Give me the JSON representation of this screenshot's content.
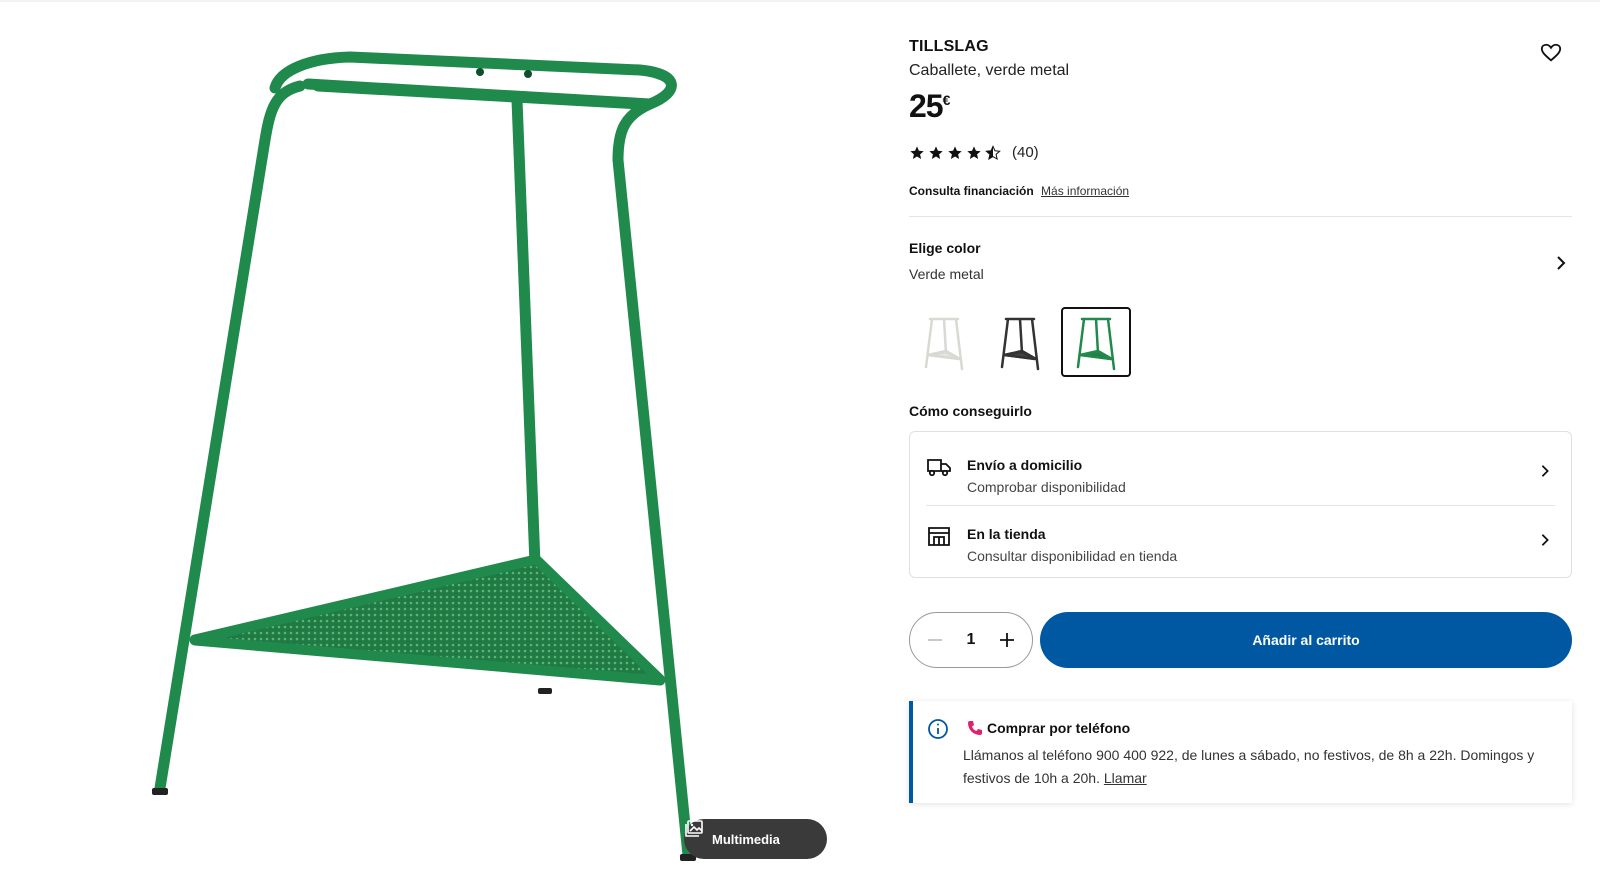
{
  "product": {
    "brand": "TILLSLAG",
    "subtitle": "Caballete, verde metal",
    "price": "25",
    "currency": "€",
    "rating_value": 4.5,
    "rating_max": 5,
    "rating_count": "(40)",
    "finance_label": "Consulta financiación",
    "finance_link": "Más información"
  },
  "media": {
    "button_label": "Multimedia",
    "icon": "gallery-icon"
  },
  "color": {
    "title": "Elige color",
    "value": "Verde metal",
    "swatches": [
      {
        "name": "white",
        "color": "#e8e8e4",
        "selected": false
      },
      {
        "name": "black",
        "color": "#333333",
        "selected": false
      },
      {
        "name": "green",
        "color": "#1f8a4c",
        "selected": true
      }
    ]
  },
  "fulfilment": {
    "title": "Cómo conseguirlo",
    "options": [
      {
        "label": "Envío a domicilio",
        "sub": "Comprobar disponibilidad",
        "icon": "truck-icon"
      },
      {
        "label": "En la tienda",
        "sub": "Consultar disponibilidad en tienda",
        "icon": "store-icon"
      }
    ]
  },
  "purchase": {
    "quantity": "1",
    "add_to_cart": "Añadir al carrito"
  },
  "phone_box": {
    "title": "Comprar por teléfono",
    "body": "Llámanos al teléfono 900 400 922, de lunes a sábado, no festivos, de 8h a 22h. Domingos y festivos de 10h a 20h.",
    "link": "Llamar"
  },
  "colors": {
    "product_green": "#1f8a4c",
    "cta_blue": "#0058a3",
    "phone_pink": "#e0226e"
  }
}
